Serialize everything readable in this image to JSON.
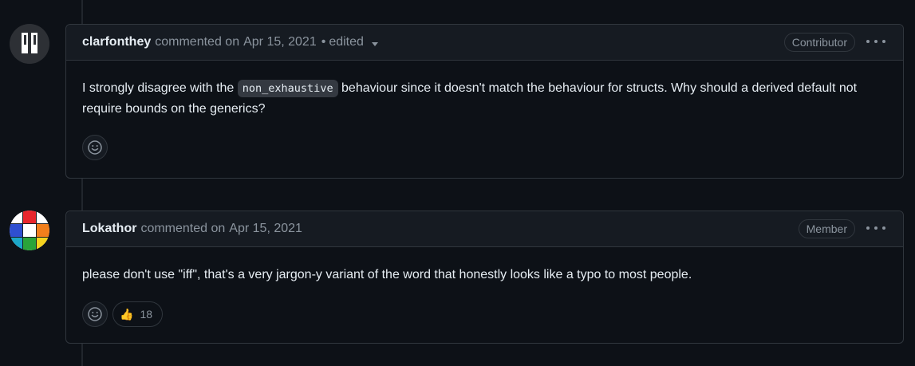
{
  "comments": [
    {
      "author": "clarfonthey",
      "action": "commented on",
      "date": "Apr 15, 2021",
      "separator": "•",
      "edited": "edited",
      "badge": "Contributor",
      "body_before": "I strongly disagree with the",
      "body_code": "non_exhaustive",
      "body_after": "behaviour since it doesn't match the behaviour for structs. Why should a derived default not require bounds on the generics?",
      "reactions": []
    },
    {
      "author": "Lokathor",
      "action": "commented on",
      "date": "Apr 15, 2021",
      "badge": "Member",
      "body": "please don't use \"iff\", that's a very jargon-y variant of the word that honestly looks like a typo to most people.",
      "reactions": [
        {
          "emoji": "👍",
          "count": "18"
        }
      ]
    }
  ],
  "icons": {
    "add_reaction": "smiley-icon",
    "more_actions": "kebab-horizontal-icon",
    "edited_dropdown": "triangle-down-icon"
  },
  "colors": {
    "background": "#0d1117",
    "header_bg": "#161b22",
    "border": "#30363d",
    "muted_text": "#8b949e",
    "text": "#e6edf3"
  }
}
